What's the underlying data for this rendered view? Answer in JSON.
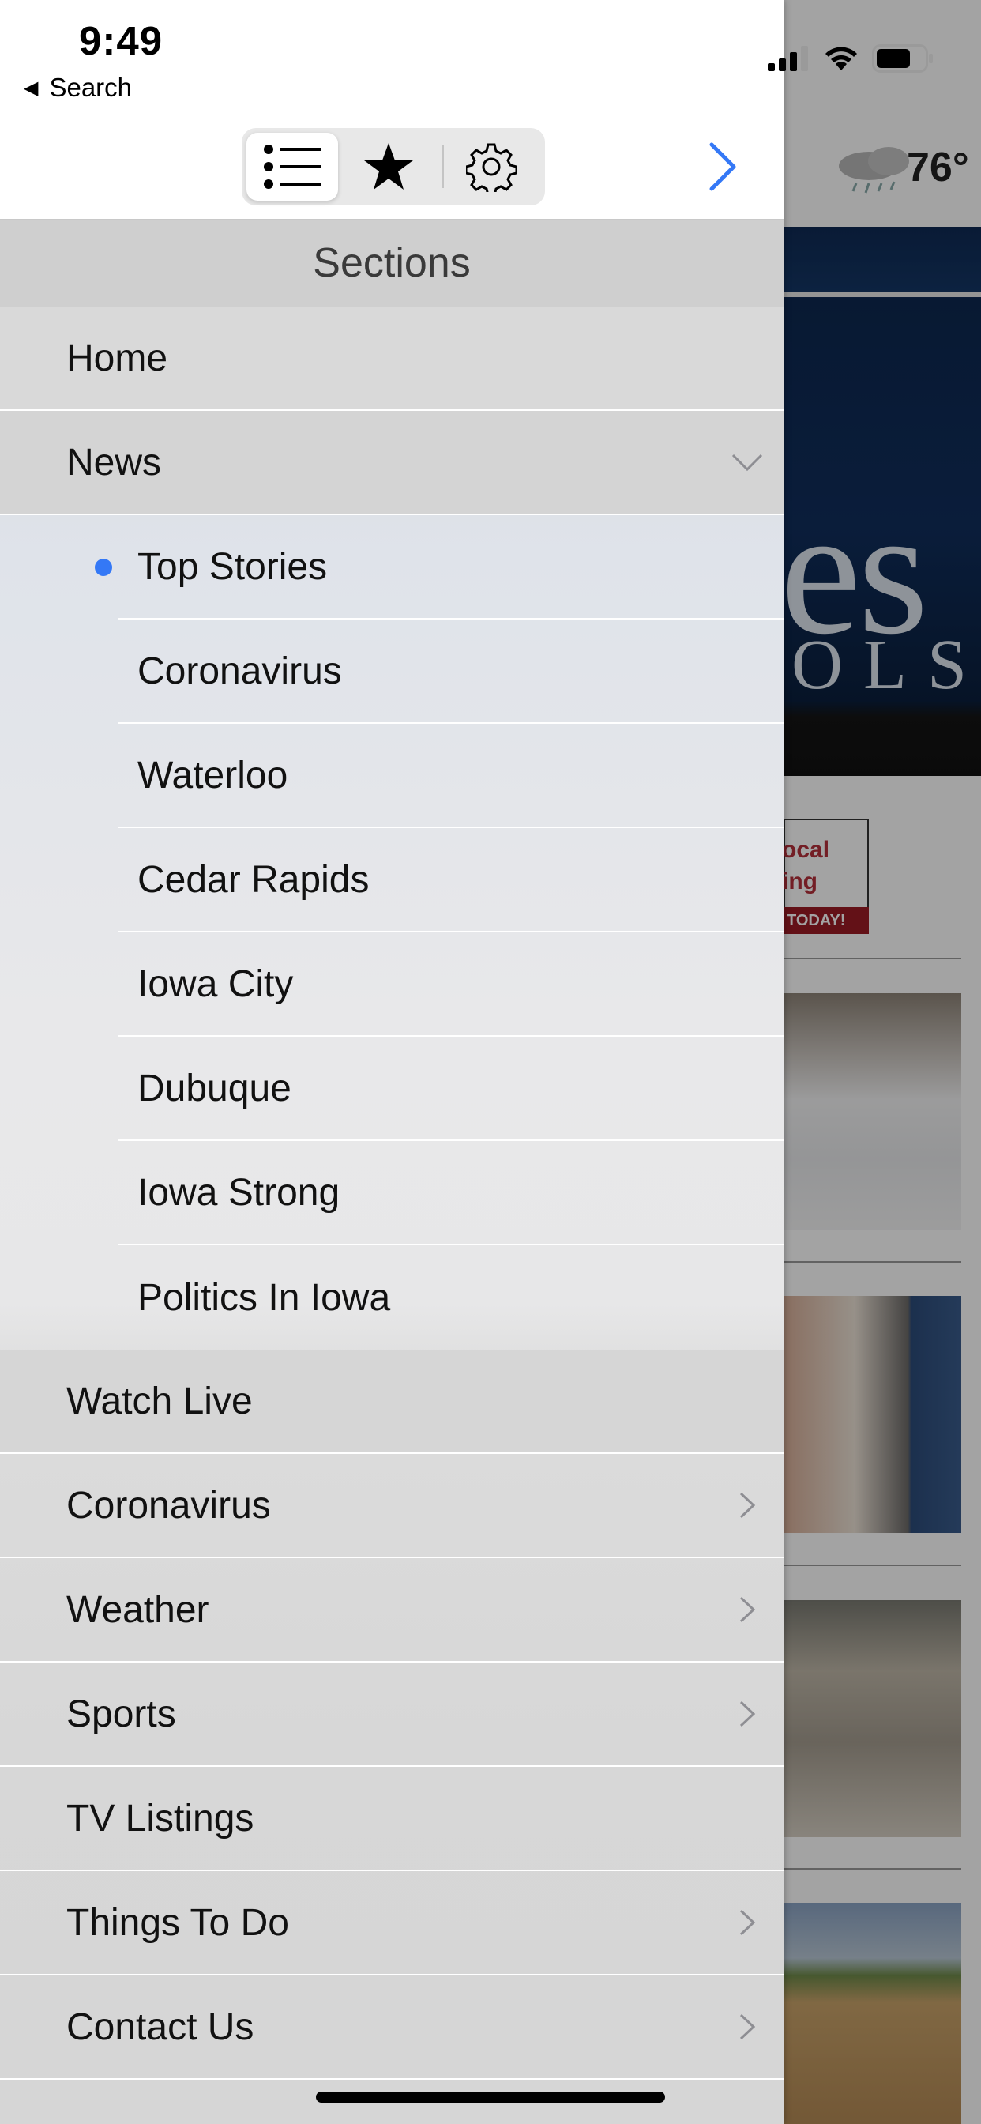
{
  "status_bar": {
    "time": "9:49",
    "back_label": "Search"
  },
  "toolbar": {
    "segments": [
      {
        "icon": "list-icon",
        "selected": true
      },
      {
        "icon": "star-icon",
        "selected": false
      },
      {
        "icon": "gear-icon",
        "selected": false
      }
    ],
    "forward_icon": "chevron-right-icon"
  },
  "menu": {
    "header": "Sections",
    "items": [
      {
        "label": "Home"
      },
      {
        "label": "News",
        "expanded": true
      },
      {
        "label": "Watch Live"
      },
      {
        "label": "Coronavirus",
        "has_children": true
      },
      {
        "label": "Weather",
        "has_children": true
      },
      {
        "label": "Sports",
        "has_children": true
      },
      {
        "label": "TV Listings"
      },
      {
        "label": "Things To Do",
        "has_children": true
      },
      {
        "label": "Contact Us",
        "has_children": true
      }
    ],
    "news_subitems": [
      {
        "label": "Top Stories",
        "selected": true
      },
      {
        "label": "Coronavirus"
      },
      {
        "label": "Waterloo"
      },
      {
        "label": "Cedar Rapids"
      },
      {
        "label": "Iowa City"
      },
      {
        "label": "Dubuque"
      },
      {
        "label": "Iowa Strong"
      },
      {
        "label": "Politics In Iowa"
      }
    ]
  },
  "background": {
    "temperature": "76°",
    "partial_header": "s",
    "hero_text_large": "es",
    "hero_text_small": "OLS",
    "ad_text": [
      "ocal",
      "ing"
    ],
    "ad_footer": "TODAY!"
  },
  "colors": {
    "accent": "#3478f6",
    "selected_dot": "#3478f6",
    "chevron": "#8e8e93"
  }
}
